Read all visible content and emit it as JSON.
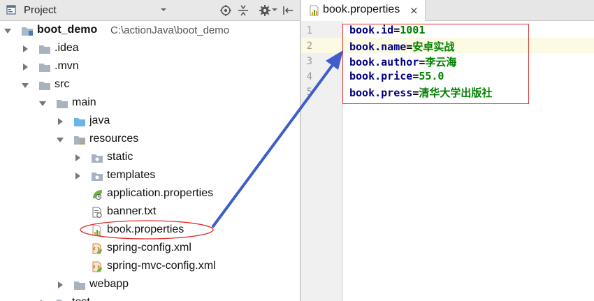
{
  "panel": {
    "title": "Project"
  },
  "tree": {
    "root": {
      "label": "boot_demo",
      "path": "C:\\actionJava\\boot_demo"
    },
    "items": [
      {
        "label": ".idea"
      },
      {
        "label": ".mvn"
      },
      {
        "label": "src"
      },
      {
        "label": "main"
      },
      {
        "label": "java"
      },
      {
        "label": "resources"
      },
      {
        "label": "static"
      },
      {
        "label": "templates"
      },
      {
        "label": "application.properties"
      },
      {
        "label": "banner.txt"
      },
      {
        "label": "book.properties"
      },
      {
        "label": "spring-config.xml"
      },
      {
        "label": "spring-mvc-config.xml"
      },
      {
        "label": "webapp"
      },
      {
        "label": "test"
      }
    ]
  },
  "editor": {
    "tab_label": "book.properties",
    "close_glyph": "×",
    "line_numbers": [
      "1",
      "2",
      "3",
      "4",
      "5"
    ],
    "lines": [
      {
        "key": "book.id",
        "eq": "=",
        "value": "1001"
      },
      {
        "key": "book.name",
        "eq": "=",
        "value": "安卓实战"
      },
      {
        "key": "book.author",
        "eq": "=",
        "value": "李云海"
      },
      {
        "key": "book.price",
        "eq": "=",
        "value": "55.0"
      },
      {
        "key": "book.press",
        "eq": "=",
        "value": "清华大学出版社"
      }
    ]
  },
  "colors": {
    "annotation_red": "#e0312d",
    "arrow_blue": "#3f5ec9",
    "key": "#000080",
    "value": "#008000"
  }
}
